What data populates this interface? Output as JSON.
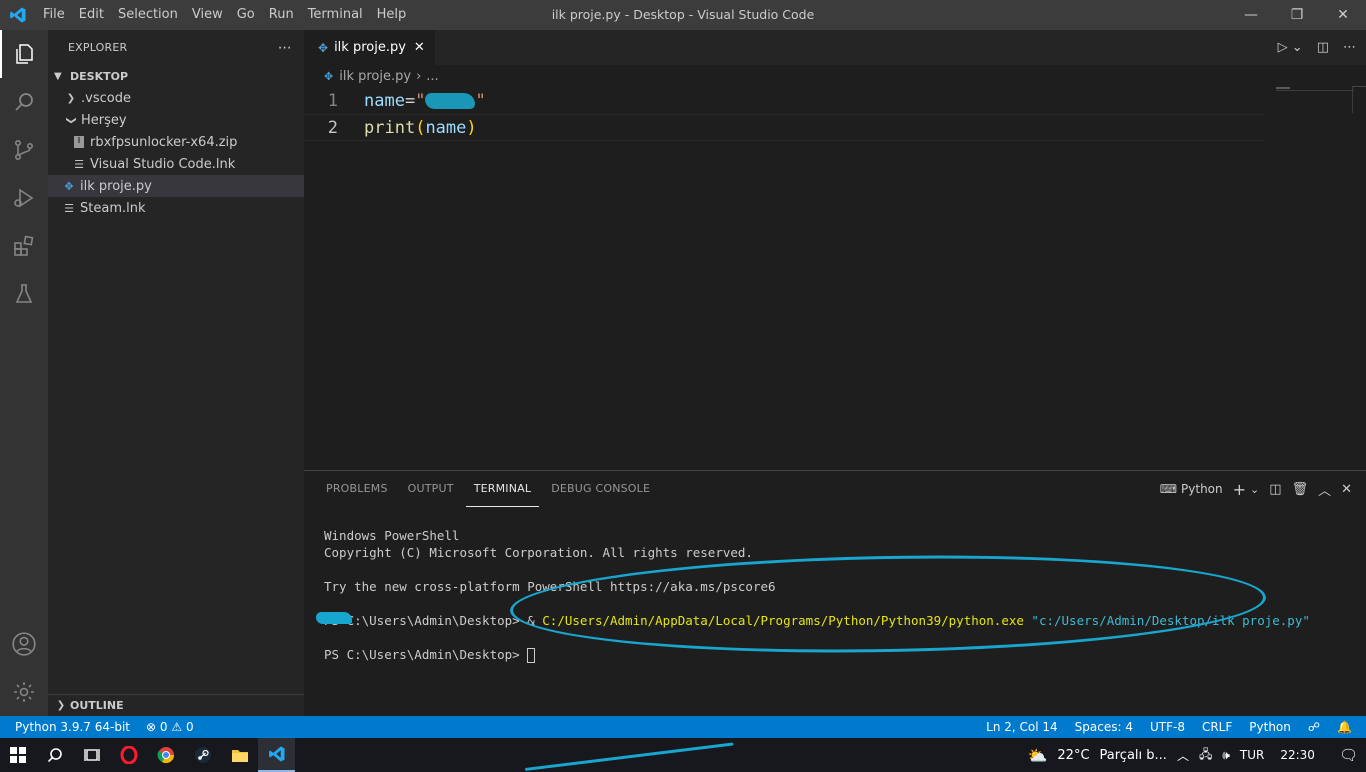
{
  "window": {
    "title": "ilk proje.py - Desktop - Visual Studio Code",
    "menu": [
      "File",
      "Edit",
      "Selection",
      "View",
      "Go",
      "Run",
      "Terminal",
      "Help"
    ]
  },
  "sidebar": {
    "title": "EXPLORER",
    "section": "DESKTOP",
    "items": [
      {
        "label": ".vscode"
      },
      {
        "label": "Herşey"
      },
      {
        "label": "rbxfpsunlocker-x64.zip"
      },
      {
        "label": "Visual Studio Code.lnk"
      },
      {
        "label": "ilk proje.py"
      },
      {
        "label": "Steam.lnk"
      }
    ],
    "outline": "OUTLINE"
  },
  "editor": {
    "tab": "ilk proje.py",
    "breadcrumb_file": "ilk proje.py",
    "breadcrumb_more": "...",
    "line_numbers": [
      "1",
      "2"
    ],
    "line1": {
      "name": "name",
      "eq": "=",
      "quote_open": "\"",
      "quote_close": "\""
    },
    "line2": {
      "fn": "print",
      "open": " (",
      "arg": "name",
      "close": ")"
    }
  },
  "panel": {
    "tabs": [
      "PROBLEMS",
      "OUTPUT",
      "TERMINAL",
      "DEBUG CONSOLE"
    ],
    "shell": "Python",
    "terminal": {
      "l1": "Windows PowerShell",
      "l2": "Copyright (C) Microsoft Corporation. All rights reserved.",
      "l3": "Try the new cross-platform PowerShell https://aka.ms/pscore6",
      "prompt": "PS C:\\Users\\Admin\\Desktop> ",
      "amp": "& ",
      "exe": "C:/Users/Admin/AppData/Local/Programs/Python/Python39/python.exe",
      "arg": " \"c:/Users/Admin/Desktop/ilk proje.py\"",
      "prompt2": "PS C:\\Users\\Admin\\Desktop> "
    }
  },
  "statusbar": {
    "interpreter": "Python 3.9.7 64-bit",
    "errors": "0",
    "warnings": "0",
    "position": "Ln 2, Col 14",
    "spaces": "Spaces: 4",
    "encoding": "UTF-8",
    "eol": "CRLF",
    "language": "Python"
  },
  "taskbar": {
    "temperature": "22°C",
    "weather": "Parçalı b...",
    "lang": "TUR",
    "time": "22:30"
  },
  "colors": {
    "accent": "#007acc",
    "annotation": "#18a6cf"
  }
}
